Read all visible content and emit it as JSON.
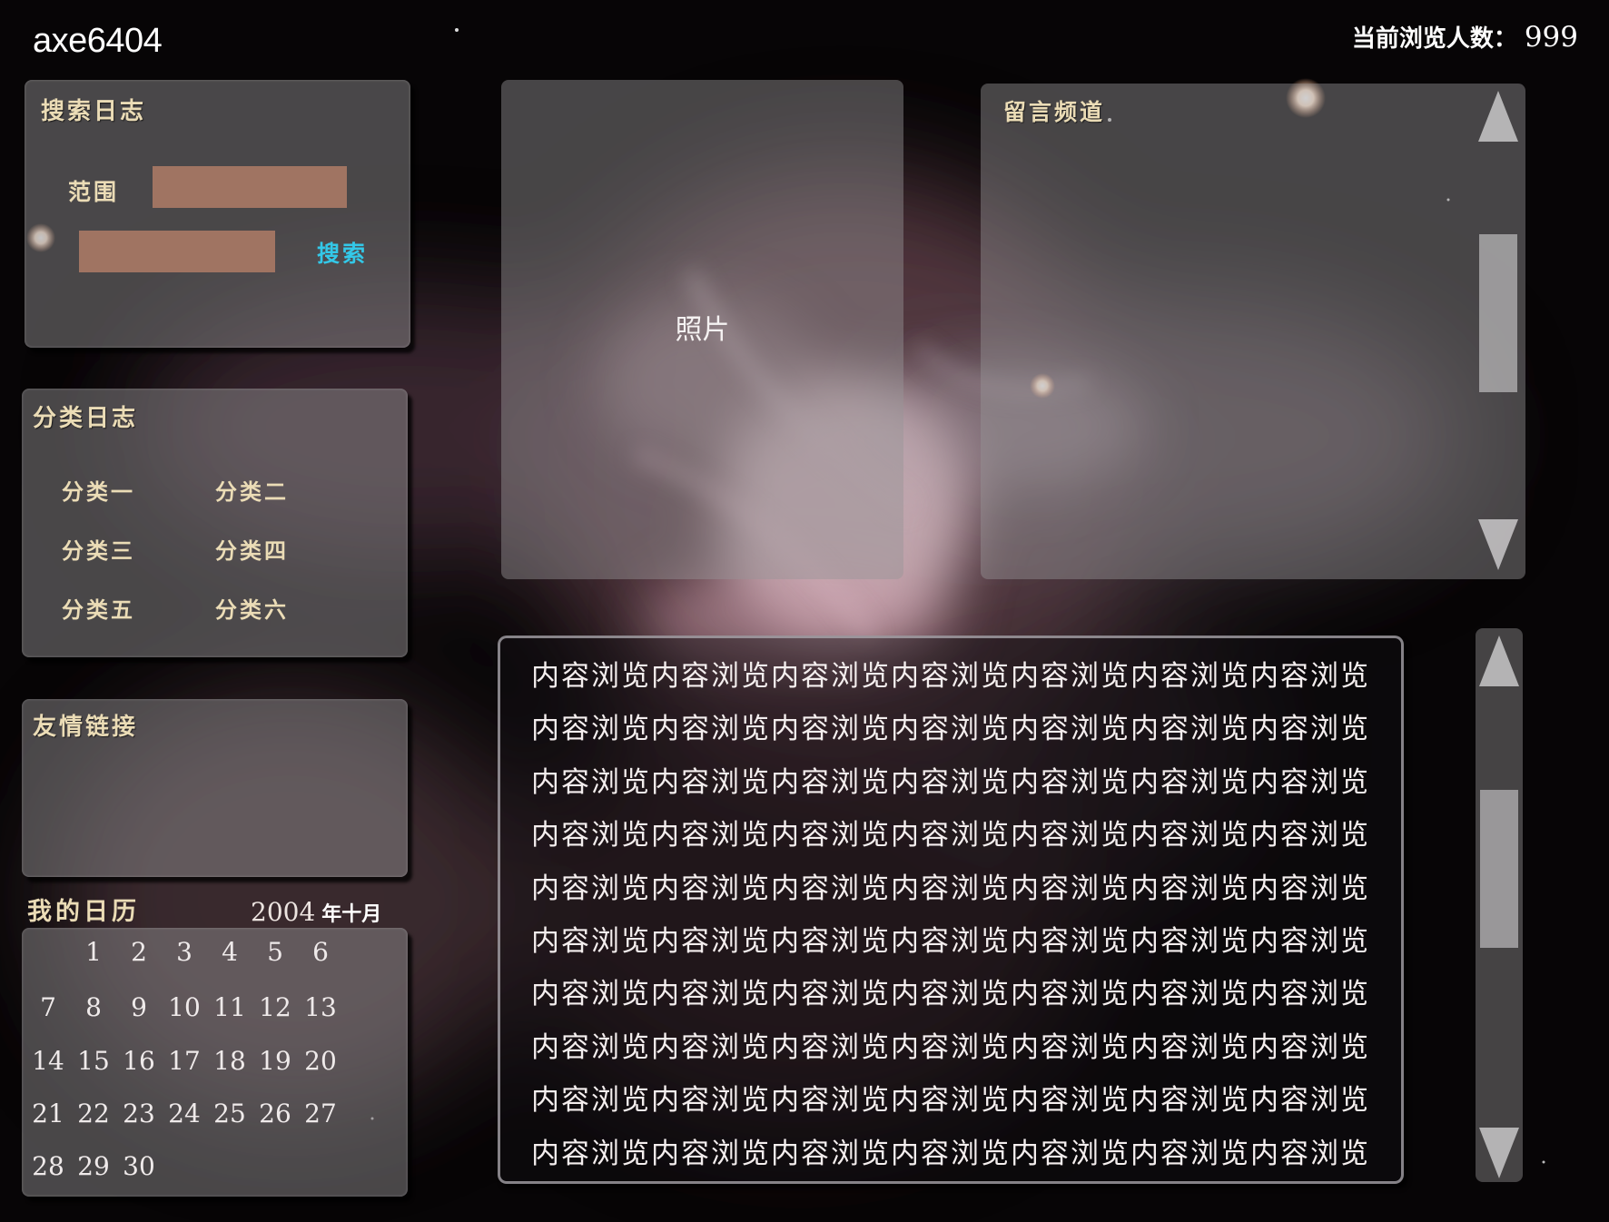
{
  "header": {
    "site_name": "axe6404",
    "visitor_label": "当前浏览人数：",
    "visitor_count": "999"
  },
  "search": {
    "title": "搜索日志",
    "range_label": "范围",
    "range_value": "",
    "keyword_value": "",
    "button_label": "搜索"
  },
  "categories": {
    "title": "分类日志",
    "items": [
      "分类一",
      "分类二",
      "分类三",
      "分类四",
      "分类五",
      "分类六"
    ]
  },
  "links": {
    "title": "友情链接"
  },
  "calendar": {
    "title": "我的日历",
    "year": "2004",
    "month": "年十月",
    "days": [
      "1",
      "2",
      "3",
      "4",
      "5",
      "6",
      "7",
      "8",
      "9",
      "10",
      "11",
      "12",
      "13",
      "14",
      "15",
      "16",
      "17",
      "18",
      "19",
      "20",
      "21",
      "22",
      "23",
      "24",
      "25",
      "26",
      "27",
      "28",
      "29",
      "30"
    ]
  },
  "photo": {
    "label": "照片"
  },
  "guestbook": {
    "title": "留言频道"
  },
  "content": {
    "lines": [
      "内容浏览内容浏览内容浏览内容浏览内容浏览内容浏览内容浏览",
      "内容浏览内容浏览内容浏览内容浏览内容浏览内容浏览内容浏览",
      "内容浏览内容浏览内容浏览内容浏览内容浏览内容浏览内容浏览",
      "内容浏览内容浏览内容浏览内容浏览内容浏览内容浏览内容浏览",
      "内容浏览内容浏览内容浏览内容浏览内容浏览内容浏览内容浏览",
      "内容浏览内容浏览内容浏览内容浏览内容浏览内容浏览内容浏览",
      "内容浏览内容浏览内容浏览内容浏览内容浏览内容浏览内容浏览",
      "内容浏览内容浏览内容浏览内容浏览内容浏览内容浏览内容浏览",
      "内容浏览内容浏览内容浏览内容浏览内容浏览内容浏览内容浏览",
      "内容浏览内容浏览内容浏览内容浏览内容浏览内容浏览内容浏览"
    ]
  },
  "colors": {
    "label_gold": "#ebdcb6",
    "input_fill": "#a07462",
    "search_link": "#33c8e8"
  }
}
